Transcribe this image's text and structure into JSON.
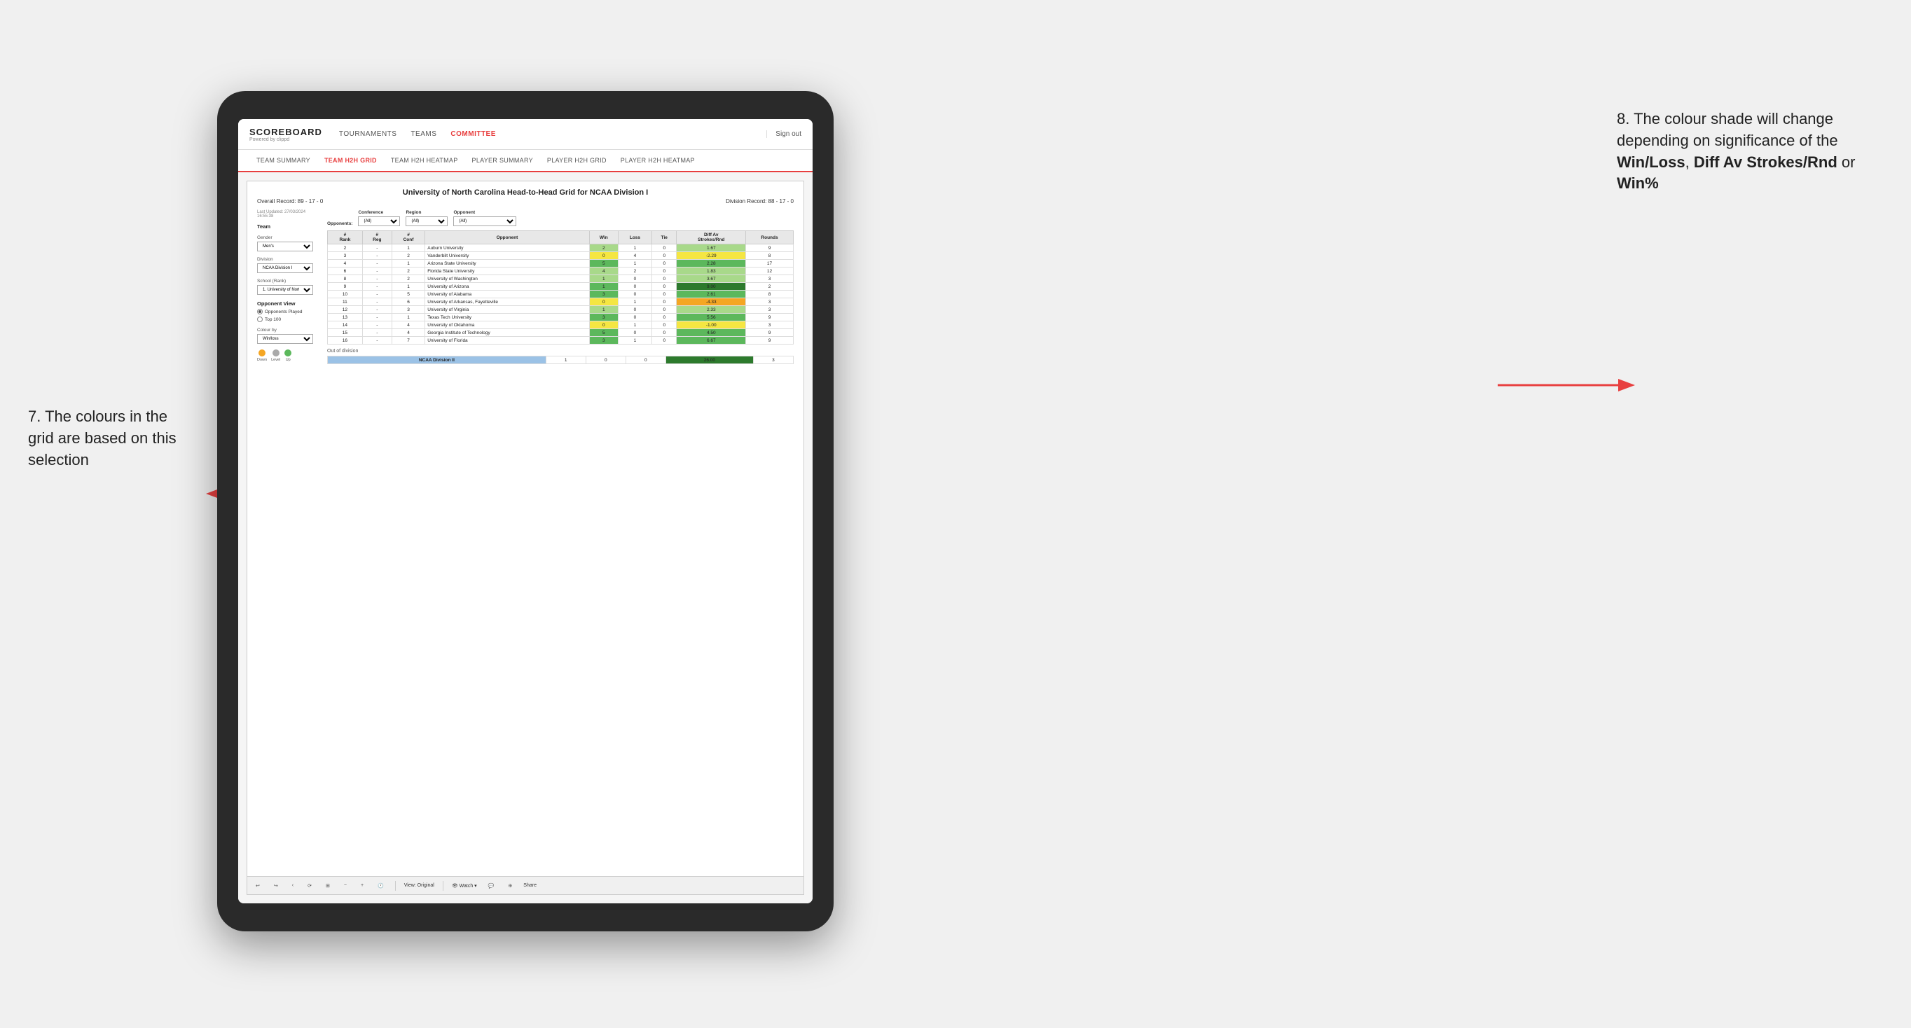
{
  "app": {
    "logo": "SCOREBOARD",
    "logo_sub": "Powered by clippd",
    "nav": [
      "TOURNAMENTS",
      "TEAMS",
      "COMMITTEE"
    ],
    "sign_out": "Sign out",
    "sub_nav": [
      "TEAM SUMMARY",
      "TEAM H2H GRID",
      "TEAM H2H HEATMAP",
      "PLAYER SUMMARY",
      "PLAYER H2H GRID",
      "PLAYER H2H HEATMAP"
    ]
  },
  "report": {
    "title": "University of North Carolina Head-to-Head Grid for NCAA Division I",
    "overall_record": "Overall Record: 89 - 17 - 0",
    "division_record": "Division Record: 88 - 17 - 0",
    "timestamp": "Last Updated: 27/03/2024\n16:55:38",
    "left_panel": {
      "team_label": "Team",
      "gender_label": "Gender",
      "gender_value": "Men's",
      "division_label": "Division",
      "division_value": "NCAA Division I",
      "school_label": "School (Rank)",
      "school_value": "1. University of Nort...",
      "opponent_view_label": "Opponent View",
      "radio_options": [
        "Opponents Played",
        "Top 100"
      ],
      "colour_by_label": "Colour by",
      "colour_by_value": "Win/loss"
    },
    "legend": {
      "items": [
        {
          "label": "Down",
          "color": "#f5a623"
        },
        {
          "label": "Level",
          "color": "#aaaaaa"
        },
        {
          "label": "Up",
          "color": "#5cb85c"
        }
      ]
    },
    "filters": {
      "conference_label": "Conference",
      "conference_value": "(All)",
      "region_label": "Region",
      "region_value": "(All)",
      "opponent_label": "Opponent",
      "opponent_value": "(All)",
      "opponents_label": "Opponents:"
    },
    "grid_headers": [
      "#\nRank",
      "#\nReg",
      "#\nConf",
      "Opponent",
      "Win",
      "Loss",
      "Tie",
      "Diff Av\nStrokes/Rnd",
      "Rounds"
    ],
    "rows": [
      {
        "rank": "2",
        "reg": "-",
        "conf": "1",
        "opponent": "Auburn University",
        "win": "2",
        "loss": "1",
        "tie": "0",
        "diff": "1.67",
        "rounds": "9",
        "win_color": "green-light",
        "diff_color": "green-light"
      },
      {
        "rank": "3",
        "reg": "-",
        "conf": "2",
        "opponent": "Vanderbilt University",
        "win": "0",
        "loss": "4",
        "tie": "0",
        "diff": "-2.29",
        "rounds": "8",
        "win_color": "yellow",
        "diff_color": "yellow"
      },
      {
        "rank": "4",
        "reg": "-",
        "conf": "1",
        "opponent": "Arizona State University",
        "win": "5",
        "loss": "1",
        "tie": "0",
        "diff": "2.28",
        "rounds": "17",
        "win_color": "green-med",
        "diff_color": "green-med"
      },
      {
        "rank": "6",
        "reg": "-",
        "conf": "2",
        "opponent": "Florida State University",
        "win": "4",
        "loss": "2",
        "tie": "0",
        "diff": "1.83",
        "rounds": "12",
        "win_color": "green-light",
        "diff_color": "green-light"
      },
      {
        "rank": "8",
        "reg": "-",
        "conf": "2",
        "opponent": "University of Washington",
        "win": "1",
        "loss": "0",
        "tie": "0",
        "diff": "3.67",
        "rounds": "3",
        "win_color": "green-light",
        "diff_color": "green-light"
      },
      {
        "rank": "9",
        "reg": "-",
        "conf": "1",
        "opponent": "University of Arizona",
        "win": "1",
        "loss": "0",
        "tie": "0",
        "diff": "9.00",
        "rounds": "2",
        "win_color": "green-med",
        "diff_color": "green-dark"
      },
      {
        "rank": "10",
        "reg": "-",
        "conf": "5",
        "opponent": "University of Alabama",
        "win": "3",
        "loss": "0",
        "tie": "0",
        "diff": "2.61",
        "rounds": "8",
        "win_color": "green-med",
        "diff_color": "green-med"
      },
      {
        "rank": "11",
        "reg": "-",
        "conf": "6",
        "opponent": "University of Arkansas, Fayetteville",
        "win": "0",
        "loss": "1",
        "tie": "0",
        "diff": "-4.33",
        "rounds": "3",
        "win_color": "yellow",
        "diff_color": "orange"
      },
      {
        "rank": "12",
        "reg": "-",
        "conf": "3",
        "opponent": "University of Virginia",
        "win": "1",
        "loss": "0",
        "tie": "0",
        "diff": "2.33",
        "rounds": "3",
        "win_color": "green-light",
        "diff_color": "green-light"
      },
      {
        "rank": "13",
        "reg": "-",
        "conf": "1",
        "opponent": "Texas Tech University",
        "win": "3",
        "loss": "0",
        "tie": "0",
        "diff": "5.56",
        "rounds": "9",
        "win_color": "green-med",
        "diff_color": "green-med"
      },
      {
        "rank": "14",
        "reg": "-",
        "conf": "4",
        "opponent": "University of Oklahoma",
        "win": "0",
        "loss": "1",
        "tie": "0",
        "diff": "-1.00",
        "rounds": "3",
        "win_color": "yellow",
        "diff_color": "yellow"
      },
      {
        "rank": "15",
        "reg": "-",
        "conf": "4",
        "opponent": "Georgia Institute of Technology",
        "win": "5",
        "loss": "0",
        "tie": "0",
        "diff": "4.50",
        "rounds": "9",
        "win_color": "green-med",
        "diff_color": "green-med"
      },
      {
        "rank": "16",
        "reg": "-",
        "conf": "7",
        "opponent": "University of Florida",
        "win": "3",
        "loss": "1",
        "tie": "0",
        "diff": "6.67",
        "rounds": "9",
        "win_color": "green-med",
        "diff_color": "green-med"
      }
    ],
    "out_of_division": {
      "label": "Out of division",
      "rows": [
        {
          "label": "NCAA Division II",
          "win": "1",
          "loss": "0",
          "tie": "0",
          "diff": "26.00",
          "rounds": "3",
          "diff_color": "green-dark"
        }
      ]
    }
  },
  "toolbar": {
    "view_label": "View: Original",
    "watch_label": "Watch ▾",
    "share_label": "Share"
  },
  "annotations": {
    "left": "7. The colours in the grid are based on this selection",
    "right_line1": "8. The colour shade will change depending on significance of the ",
    "right_bold1": "Win/Loss",
    "right_line2": ", ",
    "right_bold2": "Diff Av Strokes/Rnd",
    "right_line3": " or ",
    "right_bold3": "Win%"
  }
}
